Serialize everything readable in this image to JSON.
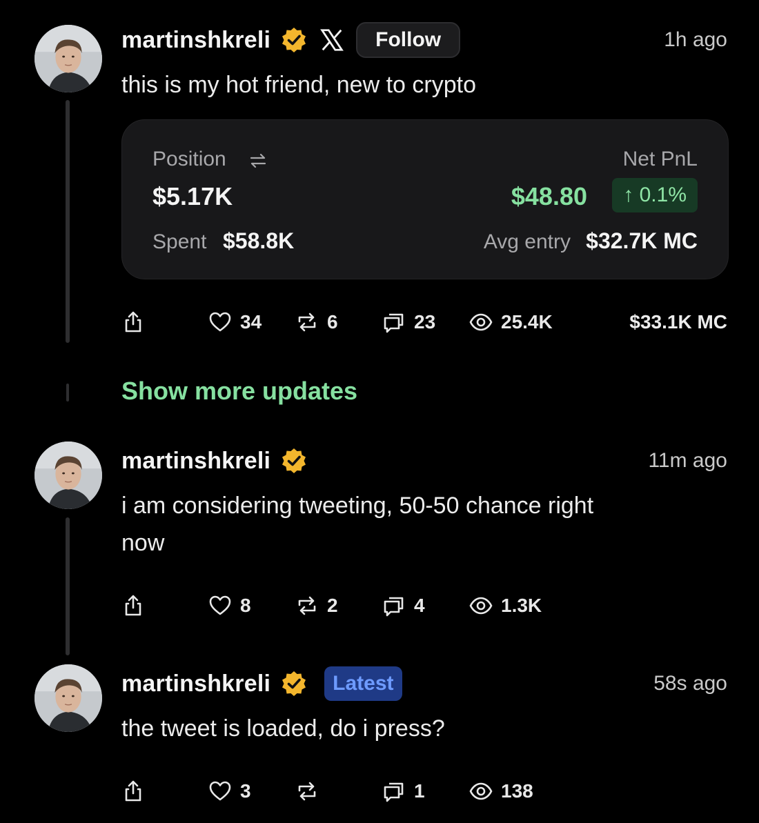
{
  "posts": [
    {
      "username": "martinshkreli",
      "time": "1h ago",
      "text": "this is my hot friend, new to crypto",
      "follow_label": "Follow",
      "position": {
        "position_label": "Position",
        "position_value": "$5.17K",
        "net_pnl_label": "Net PnL",
        "net_pnl_value": "$48.80",
        "pnl_change": "↑ 0.1%",
        "spent_label": "Spent",
        "spent_value": "$58.8K",
        "avg_entry_label": "Avg entry",
        "avg_entry_value": "$32.7K MC"
      },
      "likes": "34",
      "reposts": "6",
      "comments": "23",
      "views": "25.4K",
      "market_cap": "$33.1K  MC"
    },
    {
      "username": "martinshkreli",
      "time": "11m ago",
      "text_line1": "i am considering tweeting, 50-50 chance right",
      "text_line2": "now",
      "likes": "8",
      "reposts": "2",
      "comments": "4",
      "views": "1.3K"
    },
    {
      "username": "martinshkreli",
      "time": "58s ago",
      "badge": "Latest",
      "text": "the tweet is loaded, do i press?",
      "likes": "3",
      "reposts": "",
      "comments": "1",
      "views": "138"
    }
  ],
  "show_more_label": "Show more updates",
  "colors": {
    "background": "#000000",
    "accent_green": "#86e0a0",
    "verified_gold": "#f3b62d",
    "latest_badge_bg": "#1f3a86",
    "latest_badge_text": "#6e9bff"
  },
  "icons": [
    "verified-badge-icon",
    "x-logo-icon",
    "swap-icon",
    "share-icon",
    "heart-icon",
    "repost-icon",
    "comment-icon",
    "eye-icon"
  ]
}
